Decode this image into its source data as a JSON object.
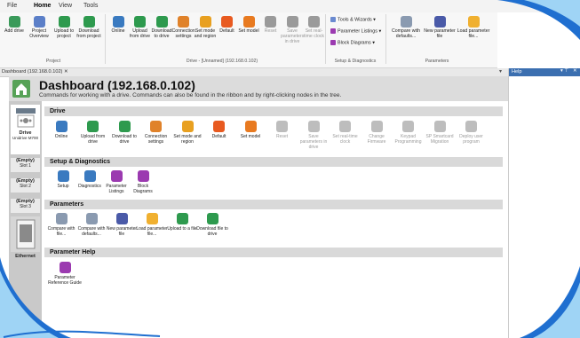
{
  "menu": {
    "tabs": [
      "File",
      "Home",
      "View",
      "Tools"
    ],
    "active": "Home"
  },
  "ribbon": {
    "project_buttons": [
      {
        "label": "Add drive",
        "icon": "add-drive-icon",
        "color": "#3a9a5a"
      },
      {
        "label": "Project Overview",
        "icon": "grid-icon",
        "color": "#5b7fc8"
      },
      {
        "label": "Upload to project",
        "icon": "upload-icon",
        "color": "#2e9a4e"
      },
      {
        "label": "Download from project",
        "icon": "download-icon",
        "color": "#2e9a4e"
      }
    ],
    "project_group": "Project",
    "drive_buttons": [
      {
        "label": "Online",
        "icon": "online-icon",
        "color": "#3a7ac0",
        "dim": false
      },
      {
        "label": "Upload from drive",
        "icon": "upload-icon",
        "color": "#2e9a4e",
        "dim": false
      },
      {
        "label": "Download to drive",
        "icon": "download-icon",
        "color": "#2e9a4e",
        "dim": false
      },
      {
        "label": "Connection settings",
        "icon": "connection-icon",
        "color": "#e0822a",
        "dim": false
      },
      {
        "label": "Set mode and region",
        "icon": "mode-icon",
        "color": "#e8a020",
        "dim": false
      },
      {
        "label": "Default",
        "icon": "default-icon",
        "color": "#e85a20",
        "dim": false
      },
      {
        "label": "Set model",
        "icon": "model-icon",
        "color": "#e87a20",
        "dim": false
      },
      {
        "label": "Reset",
        "icon": "reset-icon",
        "color": "#9a9a9a",
        "dim": true
      },
      {
        "label": "Save parameters in drive",
        "icon": "save-icon",
        "color": "#9a9a9a",
        "dim": true
      },
      {
        "label": "Set real-time clock",
        "icon": "clock-icon",
        "color": "#9a9a9a",
        "dim": true
      }
    ],
    "drive_group": "Drive - [Unnamed] (192.168.0.102)",
    "setup_items": [
      "Tools & Wizards",
      "Parameter Listings",
      "Block Diagrams"
    ],
    "setup_group": "Setup & Diagnostics",
    "param_buttons": [
      {
        "label": "Compare with defaults...",
        "icon": "compare-icon",
        "color": "#8a9ab0"
      },
      {
        "label": "New parameter file",
        "icon": "new-file-icon",
        "color": "#4a5aa8"
      },
      {
        "label": "Load parameter file...",
        "icon": "folder-icon",
        "color": "#f0b030"
      }
    ],
    "param_group": "Parameters"
  },
  "doc_tab": "Dashboard (192.168.0.102)",
  "help_title": "Help",
  "dashboard": {
    "title": "Dashboard (192.168.0.102)",
    "subtitle": "Commands for working with a drive. Commands can also be found in the ribbon and by right-clicking nodes in the tree."
  },
  "rail": {
    "drive_label": "Drive",
    "drive_sub": "Unidrive M700",
    "slots": [
      {
        "title": "(Empty)",
        "sub": "Slot 1"
      },
      {
        "title": "(Empty)",
        "sub": "Slot 2"
      },
      {
        "title": "(Empty)",
        "sub": "Slot 3"
      }
    ],
    "ethernet": "Ethernet"
  },
  "sections": {
    "drive": {
      "title": "Drive",
      "buttons": [
        {
          "label": "Online",
          "icon": "online-icon",
          "color": "#3a7ac0",
          "dim": false
        },
        {
          "label": "Upload from drive",
          "icon": "upload-icon",
          "color": "#2e9a4e",
          "dim": false
        },
        {
          "label": "Download to drive",
          "icon": "download-icon",
          "color": "#2e9a4e",
          "dim": false
        },
        {
          "label": "Connection settings",
          "icon": "connection-icon",
          "color": "#e0822a",
          "dim": false
        },
        {
          "label": "Set mode and region",
          "icon": "mode-icon",
          "color": "#e8a020",
          "dim": false
        },
        {
          "label": "Default",
          "icon": "default-icon",
          "color": "#e85a20",
          "dim": false
        },
        {
          "label": "Set model",
          "icon": "model-icon",
          "color": "#e87a20",
          "dim": false
        },
        {
          "label": "Reset",
          "icon": "reset-icon",
          "color": "#bdbdbd",
          "dim": true
        },
        {
          "label": "Save parameters in drive",
          "icon": "save-icon",
          "color": "#bdbdbd",
          "dim": true
        },
        {
          "label": "Set real-time clock",
          "icon": "clock-icon",
          "color": "#bdbdbd",
          "dim": true
        },
        {
          "label": "Change Firmware",
          "icon": "firmware-icon",
          "color": "#bdbdbd",
          "dim": true
        },
        {
          "label": "Keypad Programming",
          "icon": "keypad-icon",
          "color": "#bdbdbd",
          "dim": true
        },
        {
          "label": "SP Smartcard Migration",
          "icon": "smartcard-icon",
          "color": "#bdbdbd",
          "dim": true
        },
        {
          "label": "Deploy user program",
          "icon": "deploy-icon",
          "color": "#bdbdbd",
          "dim": true
        }
      ]
    },
    "setup": {
      "title": "Setup & Diagnostics",
      "buttons": [
        {
          "label": "Setup",
          "icon": "wrench-icon",
          "color": "#3a7ac0"
        },
        {
          "label": "Diagnostics",
          "icon": "diagnostics-icon",
          "color": "#3a7ac0"
        },
        {
          "label": "Parameter Listings",
          "icon": "listing-icon",
          "color": "#9b3ab0"
        },
        {
          "label": "Block Diagrams",
          "icon": "block-diagram-icon",
          "color": "#9b3ab0"
        }
      ]
    },
    "parameters": {
      "title": "Parameters",
      "buttons": [
        {
          "label": "Compare with file...",
          "icon": "compare-file-icon",
          "color": "#8a9ab0"
        },
        {
          "label": "Compare with defaults...",
          "icon": "compare-icon",
          "color": "#8a9ab0"
        },
        {
          "label": "New parameter file",
          "icon": "new-file-icon",
          "color": "#4a5aa8"
        },
        {
          "label": "Load parameter file...",
          "icon": "folder-icon",
          "color": "#f0b030"
        },
        {
          "label": "Upload to a file",
          "icon": "upload-file-icon",
          "color": "#2e9a4e"
        },
        {
          "label": "Download file to drive",
          "icon": "download-file-icon",
          "color": "#2e9a4e"
        }
      ]
    },
    "help": {
      "title": "Parameter Help",
      "buttons": [
        {
          "label": "Parameter Reference Guide",
          "icon": "info-icon",
          "color": "#9b3ab0"
        }
      ]
    }
  },
  "colors": {
    "frame": "#1f6fd0",
    "frame_light": "#9fd4f5"
  }
}
